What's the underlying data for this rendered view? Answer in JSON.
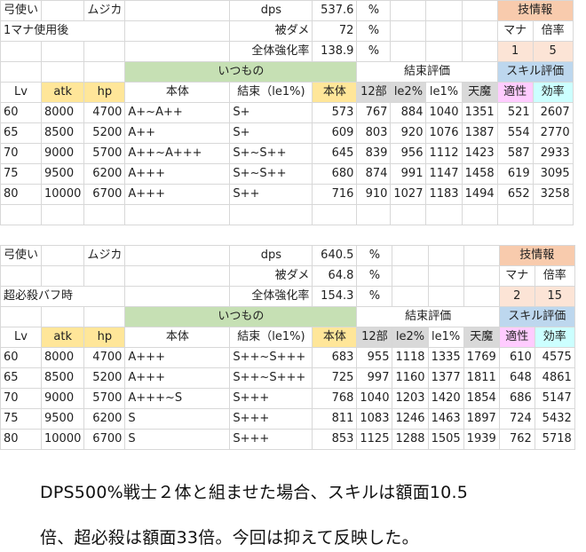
{
  "blocks": [
    {
      "class_name": "弓使い",
      "char_name": "ムジカ",
      "condition": "1マナ使用後",
      "dps_label": "dps",
      "dps_value": "537.6",
      "dps_unit": "%",
      "dmg_label": "被ダメ",
      "dmg_value": "72",
      "dmg_unit": "%",
      "boost_label": "全体強化率",
      "boost_value": "138.9",
      "boost_unit": "%",
      "skill_info": "技情報",
      "mana_label": "マナ",
      "mult_label": "倍率",
      "mana_value": "1",
      "mult_value": "5",
      "group_itsumo": "いつもの",
      "group_kessoku": "結束評価",
      "group_skill": "スキル評価",
      "headers": [
        "Lv",
        "atk",
        "hp",
        "本体",
        "結束（le1%)",
        "本体",
        "12部",
        "le2%",
        "le1%",
        "天魔",
        "適性",
        "効率"
      ],
      "rows": [
        [
          "60",
          "8000",
          "4700",
          "A+~A++",
          "S+",
          "573",
          "767",
          "884",
          "1040",
          "1351",
          "521",
          "2607"
        ],
        [
          "65",
          "8500",
          "5200",
          "A++",
          "S+",
          "609",
          "803",
          "920",
          "1076",
          "1387",
          "554",
          "2770"
        ],
        [
          "70",
          "9000",
          "5700",
          "A++~A+++",
          "S+~S++",
          "645",
          "839",
          "956",
          "1112",
          "1423",
          "587",
          "2933"
        ],
        [
          "75",
          "9500",
          "6200",
          "A+++",
          "S+~S++",
          "680",
          "874",
          "991",
          "1147",
          "1458",
          "619",
          "3095"
        ],
        [
          "80",
          "10000",
          "6700",
          "A+++",
          "S++",
          "716",
          "910",
          "1027",
          "1183",
          "1494",
          "652",
          "3258"
        ]
      ]
    },
    {
      "class_name": "弓使い",
      "char_name": "ムジカ",
      "condition": "超必殺バフ時",
      "dps_label": "dps",
      "dps_value": "640.5",
      "dps_unit": "%",
      "dmg_label": "被ダメ",
      "dmg_value": "64.8",
      "dmg_unit": "%",
      "boost_label": "全体強化率",
      "boost_value": "154.3",
      "boost_unit": "%",
      "skill_info": "技情報",
      "mana_label": "マナ",
      "mult_label": "倍率",
      "mana_value": "2",
      "mult_value": "15",
      "group_itsumo": "いつもの",
      "group_kessoku": "結束評価",
      "group_skill": "スキル評価",
      "headers": [
        "Lv",
        "atk",
        "hp",
        "本体",
        "結束（le1%)",
        "本体",
        "12部",
        "le2%",
        "le1%",
        "天魔",
        "適性",
        "効率"
      ],
      "rows": [
        [
          "60",
          "8000",
          "4700",
          "A+++",
          "S++~S+++",
          "683",
          "955",
          "1118",
          "1335",
          "1769",
          "610",
          "4575"
        ],
        [
          "65",
          "8500",
          "5200",
          "A+++",
          "S++~S+++",
          "725",
          "997",
          "1160",
          "1377",
          "1811",
          "648",
          "4861"
        ],
        [
          "70",
          "9000",
          "5700",
          "A+++~S",
          "S+++",
          "768",
          "1040",
          "1203",
          "1420",
          "1854",
          "686",
          "5147"
        ],
        [
          "75",
          "9500",
          "6200",
          "S",
          "S+++",
          "811",
          "1083",
          "1246",
          "1463",
          "1897",
          "724",
          "5432"
        ],
        [
          "80",
          "10000",
          "6700",
          "S",
          "S+++",
          "853",
          "1125",
          "1288",
          "1505",
          "1939",
          "762",
          "5718"
        ]
      ]
    }
  ],
  "note_line1": "DPS500%戦士２体と組ませた場合、スキルは額面10.5",
  "note_line2": "倍、超必殺は額面33倍。今回は抑えて反映した。"
}
